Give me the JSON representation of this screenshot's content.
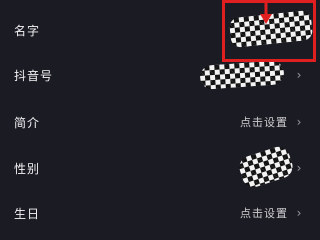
{
  "rows": [
    {
      "label": "名字",
      "value": "",
      "show_chevron": false
    },
    {
      "label": "抖音号",
      "value": "",
      "show_chevron": true
    },
    {
      "label": "简介",
      "value": "点击设置",
      "show_chevron": true
    },
    {
      "label": "性别",
      "value": "",
      "show_chevron": true
    },
    {
      "label": "生日",
      "value": "点击设置",
      "show_chevron": true
    }
  ],
  "icons": {
    "chevron": "chevron-right-icon",
    "highlight_arrow": "arrow-down-icon"
  },
  "colors": {
    "background": "#1b1b24",
    "highlight": "#e02020"
  }
}
